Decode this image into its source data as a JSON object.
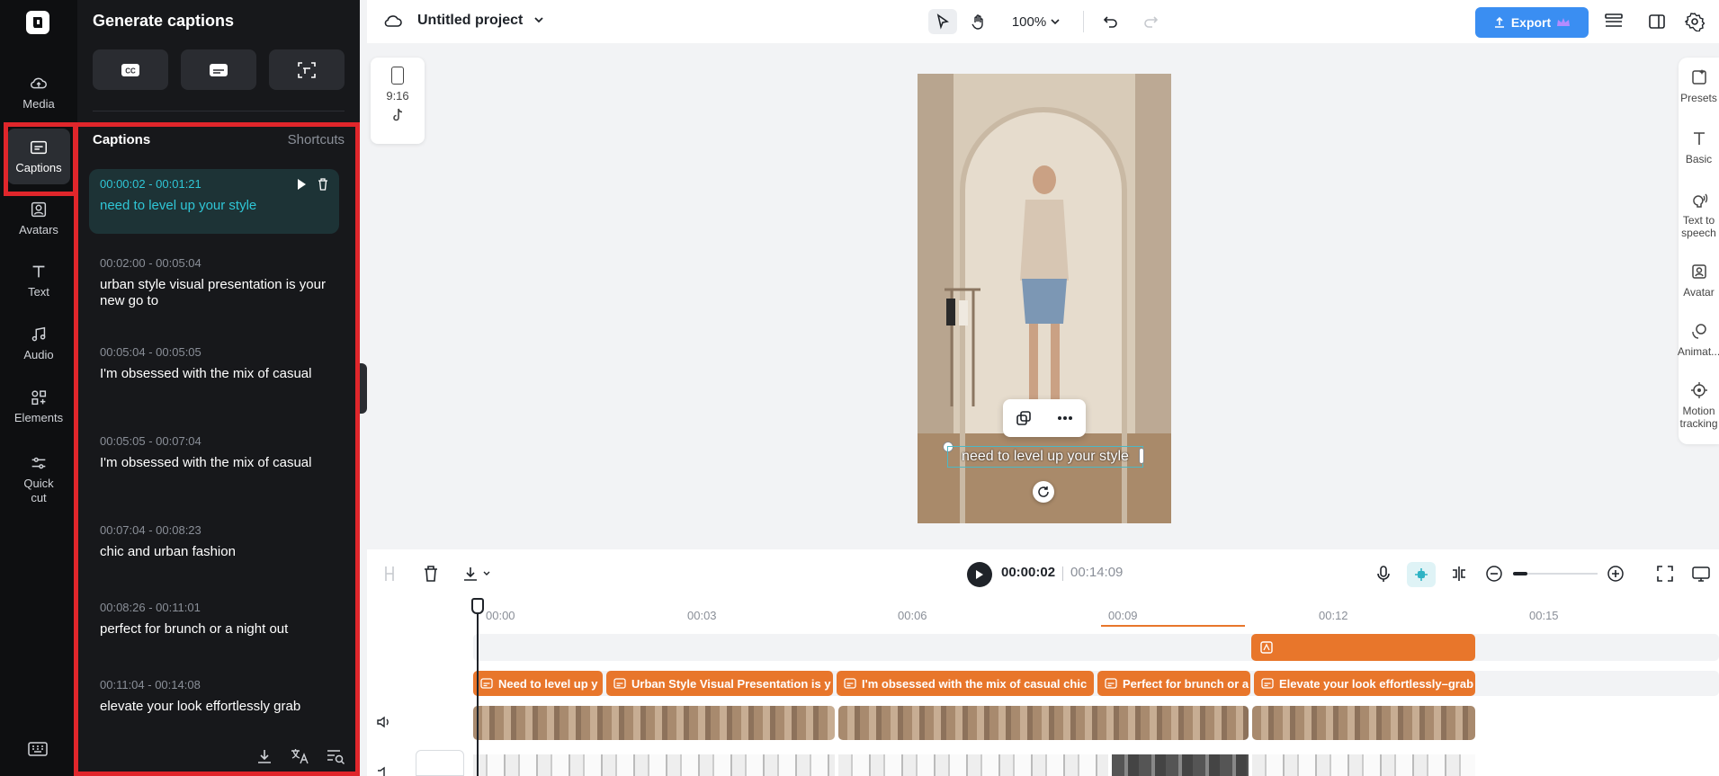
{
  "rail": {
    "items": [
      {
        "label": "Media",
        "icon": "cloud-upload-icon"
      },
      {
        "label": "Captions",
        "icon": "captions-icon"
      },
      {
        "label": "Avatars",
        "icon": "avatar-icon"
      },
      {
        "label": "Text",
        "icon": "text-icon"
      },
      {
        "label": "Audio",
        "icon": "music-note-icon"
      },
      {
        "label": "Elements",
        "icon": "elements-icon"
      },
      {
        "label": "Quick cut",
        "icon": "quick-cut-icon"
      }
    ],
    "active": "Captions",
    "keyboard_icon": "keyboard-icon"
  },
  "panel": {
    "title": "Generate captions",
    "captions_heading": "Captions",
    "shortcuts_label": "Shortcuts",
    "captions": [
      {
        "time": "00:00:02 - 00:01:21",
        "text": "need to level up your style",
        "active": true
      },
      {
        "time": "00:02:00 - 00:05:04",
        "text": "urban style visual presentation is your new go to"
      },
      {
        "time": "00:05:04 - 00:05:05",
        "text": "I'm obsessed with the mix of casual"
      },
      {
        "time": "00:05:05 - 00:07:04",
        "text": "I'm obsessed with the mix of casual"
      },
      {
        "time": "00:07:04 - 00:08:23",
        "text": "chic and urban fashion"
      },
      {
        "time": "00:08:26 - 00:11:01",
        "text": "perfect for brunch or a night out"
      },
      {
        "time": "00:11:04 - 00:14:08",
        "text": "elevate your look effortlessly grab"
      }
    ]
  },
  "topbar": {
    "project_title": "Untitled project",
    "zoom": "100%",
    "export_label": "Export"
  },
  "canvas": {
    "ratio": "9:16",
    "subtitle": "need to level up your style"
  },
  "props": [
    {
      "label": "Presets"
    },
    {
      "label": "Basic"
    },
    {
      "label": "Text to speech"
    },
    {
      "label": "Avatar"
    },
    {
      "label": "Animat..."
    },
    {
      "label": "Motion tracking"
    }
  ],
  "timeline": {
    "current": "00:00:02",
    "total": "00:14:09",
    "ticks": [
      "00:00",
      "00:03",
      "00:06",
      "00:09",
      "00:12",
      "00:15"
    ],
    "caption_clips": [
      "Need to level up y",
      "Urban Style Visual Presentation is y",
      "I'm obsessed with the mix of casual chic",
      "Perfect for brunch or a",
      "Elevate your look effortlessly–grab"
    ]
  },
  "colors": {
    "accent": "#3a8ef2",
    "caption_clip": "#e8762b",
    "highlight": "#e0262b",
    "active_caption": "#2fc6d6"
  }
}
